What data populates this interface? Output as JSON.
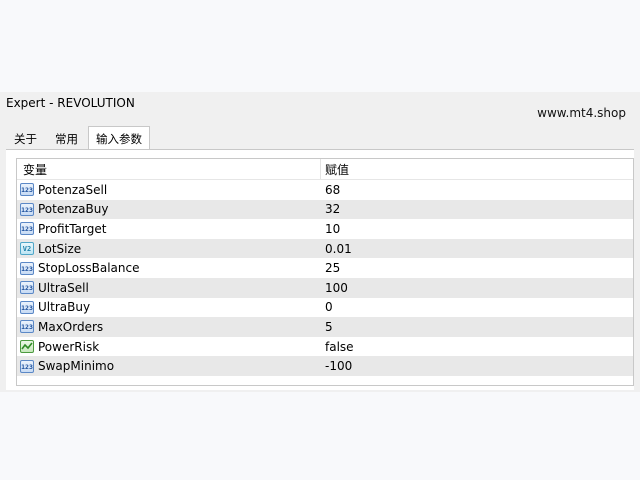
{
  "window": {
    "title": "Expert - REVOLUTION",
    "watermark": "www.mt4.shop"
  },
  "tabs": [
    {
      "label": "关于",
      "active": false
    },
    {
      "label": "常用",
      "active": false
    },
    {
      "label": "输入参数",
      "active": true
    }
  ],
  "table": {
    "headers": {
      "variable": "变量",
      "value": "赋值"
    },
    "rows": [
      {
        "name": "PotenzaSell",
        "value": "68",
        "icon": "int-icon"
      },
      {
        "name": "PotenzaBuy",
        "value": "32",
        "icon": "int-icon"
      },
      {
        "name": "ProfitTarget",
        "value": "10",
        "icon": "int-icon"
      },
      {
        "name": "LotSize",
        "value": "0.01",
        "icon": "double-icon"
      },
      {
        "name": "StopLossBalance",
        "value": "25",
        "icon": "int-icon"
      },
      {
        "name": "UltraSell",
        "value": "100",
        "icon": "int-icon"
      },
      {
        "name": "UltraBuy",
        "value": "0",
        "icon": "int-icon"
      },
      {
        "name": "MaxOrders",
        "value": "5",
        "icon": "int-icon"
      },
      {
        "name": "PowerRisk",
        "value": "false",
        "icon": "bool-icon"
      },
      {
        "name": "SwapMinimo",
        "value": "-100",
        "icon": "int-icon"
      }
    ]
  }
}
